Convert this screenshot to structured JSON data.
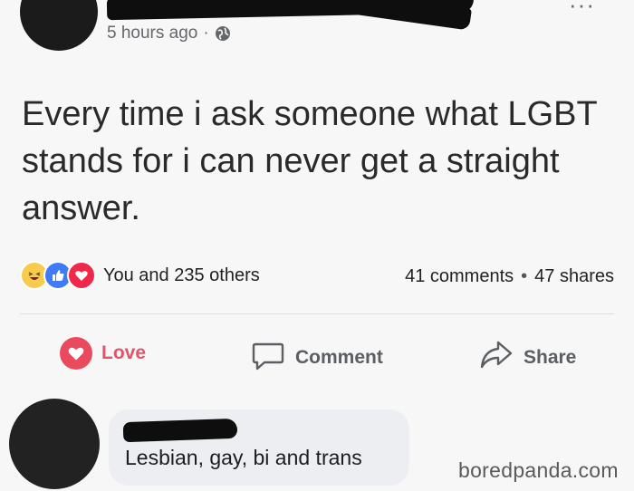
{
  "post": {
    "timestamp": "5 hours ago",
    "separator": "·",
    "text": "Every time i ask someone what LGBT stands for i can never get a straight answer.",
    "more_glyph": "···"
  },
  "reactions": {
    "icons": [
      "haha-icon",
      "like-icon",
      "love-icon"
    ],
    "summary": "You and 235 others",
    "comments": "41 comments",
    "stats_separator": "•",
    "shares": "47 shares"
  },
  "actions": {
    "love_label": "Love",
    "comment_label": "Comment",
    "share_label": "Share"
  },
  "comment": {
    "text": "Lesbian, gay, bi and trans"
  },
  "watermark": "boredpanda.com",
  "colors": {
    "love_red": "#ea4a5d",
    "like_blue": "#3f7bf4",
    "haha_yellow": "#f7cb4d",
    "muted_text": "#65676b"
  }
}
